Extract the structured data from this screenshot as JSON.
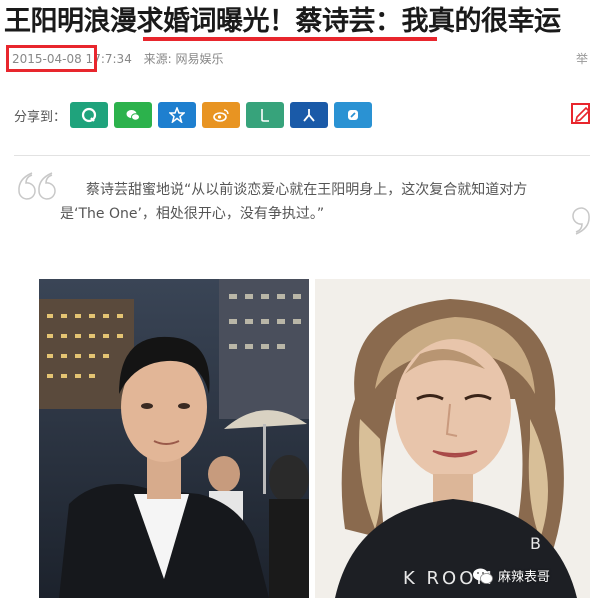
{
  "article": {
    "headline": "王阳明浪漫求婚词曝光！蔡诗芸：我真的很幸运",
    "date": "2015-04-08 17:",
    "time_rest": "7:34",
    "source": "来源: 网易娱乐",
    "report_label": "举"
  },
  "share": {
    "label": "分享到：",
    "buttons": [
      {
        "name": "qq",
        "color": "#1fa37c"
      },
      {
        "name": "wechat",
        "color": "#2cb24c"
      },
      {
        "name": "qzone",
        "color": "#1e7fcf"
      },
      {
        "name": "weibo",
        "color": "#e89422"
      },
      {
        "name": "lofter",
        "color": "#37a37b"
      },
      {
        "name": "renren",
        "color": "#1a5aa8"
      },
      {
        "name": "yixin",
        "color": "#2a92d3"
      }
    ]
  },
  "quote": {
    "line1": "蔡诗芸甜蜜地说“从以前谈恋爱心就在王阳明身上，这次复合就知道对方",
    "line2": "是‘The One’，相处很开心，没有争执过。”"
  },
  "watermark": {
    "text": "麻辣表哥"
  },
  "colors": {
    "accent_red": "#e8262d"
  }
}
